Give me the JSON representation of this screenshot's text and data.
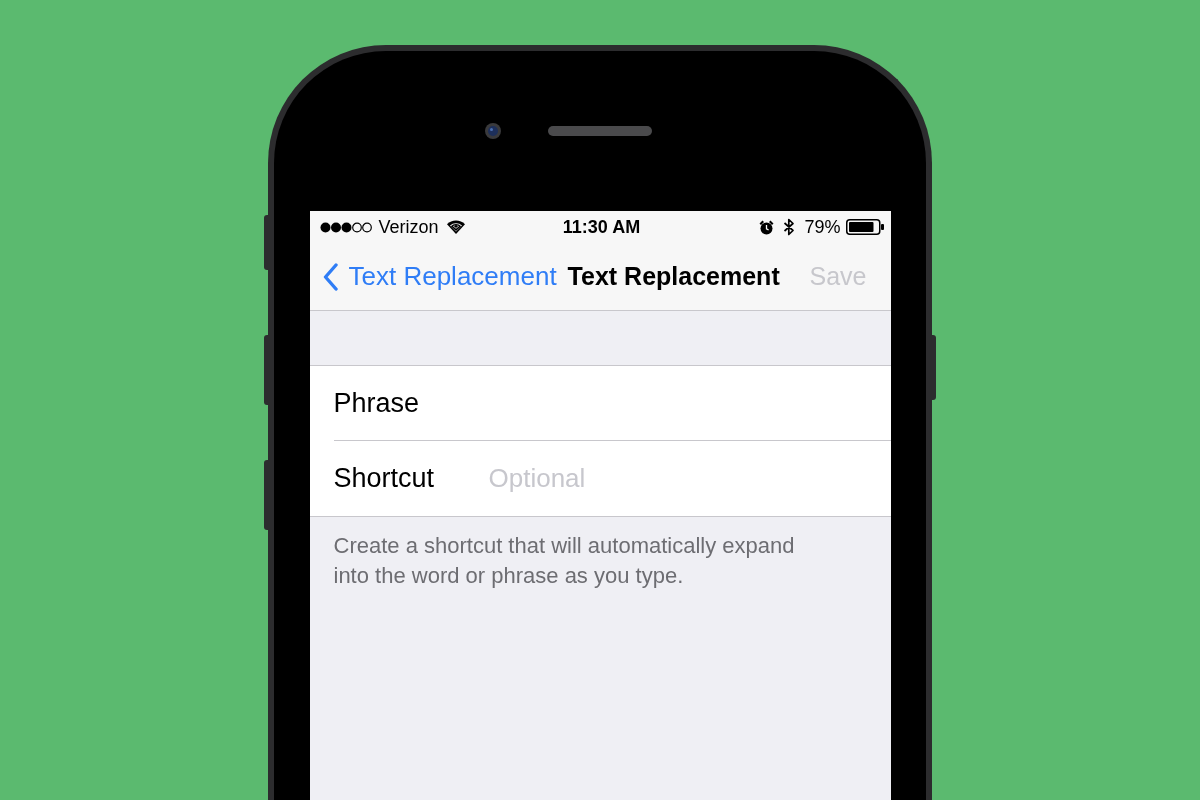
{
  "status_bar": {
    "carrier": "Verizon",
    "time": "11:30 AM",
    "battery": "79%"
  },
  "nav_bar": {
    "back": {
      "label": "Text Replacement"
    },
    "title": "Text Replacement",
    "save": {
      "label": "Save",
      "disabled": true
    }
  },
  "form": {
    "fields": [
      {
        "label": "Phrase"
      },
      {
        "label": "Shortcut",
        "placeholder": "Optional"
      }
    ],
    "footer": "Create a shortcut that will automatically expand into the word or phrase as you type."
  }
}
